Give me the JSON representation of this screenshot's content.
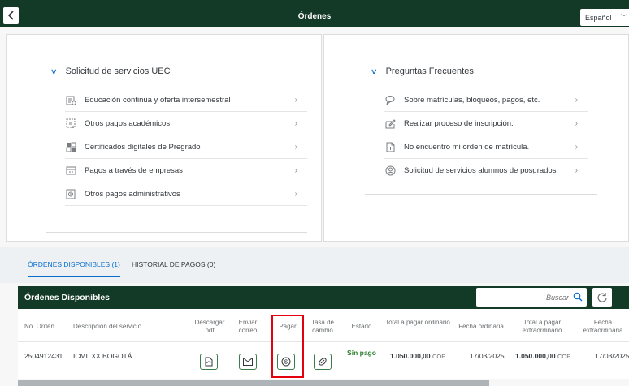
{
  "header": {
    "title": "Órdenes",
    "language": "Español"
  },
  "services": {
    "title": "Solicitud de servicios UEC",
    "items": [
      {
        "label": "Educación continua y oferta intersemestral",
        "icon": "education-icon"
      },
      {
        "label": "Otros pagos académicos.",
        "icon": "payment-list-icon"
      },
      {
        "label": "Certificados digitales de Pregrado",
        "icon": "certificate-icon"
      },
      {
        "label": "Pagos a través de empresas",
        "icon": "company-payment-icon"
      },
      {
        "label": "Otros pagos administrativos",
        "icon": "admin-payment-icon"
      }
    ]
  },
  "faq": {
    "title": "Preguntas Frecuentes",
    "items": [
      {
        "label": "Sobre matrículas, bloqueos, pagos, etc.",
        "icon": "chat-icon"
      },
      {
        "label": "Realizar proceso de inscripción.",
        "icon": "edit-form-icon"
      },
      {
        "label": "No encuentro mi orden de matrícula.",
        "icon": "document-icon"
      },
      {
        "label": "Solicitud de servicios alumnos de posgrados",
        "icon": "graduate-icon"
      }
    ]
  },
  "tabs": [
    {
      "label": "ÓRDENES DISPONIBLES (1)",
      "active": true
    },
    {
      "label": "HISTORIAL DE PAGOS (0)",
      "active": false
    }
  ],
  "table": {
    "title": "Órdenes Disponibles",
    "search_placeholder": "Buscar",
    "columns": [
      "No. Orden",
      "Descripción del servicio",
      "Descargar pdf",
      "Enviar correo",
      "Pagar",
      "Tasa de cambio",
      "Estado",
      "Total a pagar ordinario",
      "Fecha ordinaria",
      "Total a pagar extraordinario",
      "Fecha extraordinaria"
    ],
    "rows": [
      {
        "order": "2504912431",
        "description": "ICML XX BOGOTÁ",
        "status": "Sin pago",
        "total_ordinary": "1.050.000,00",
        "currency": "COP",
        "date_ordinary": "17/03/2025",
        "total_extraordinary": "1.050.000,00",
        "date_extraordinary": "17/03/2025"
      }
    ]
  },
  "colors": {
    "header_bg": "#133a27",
    "accent": "#0a6ed1",
    "status_green": "#2b7c2b",
    "highlight": "#e3000f"
  }
}
